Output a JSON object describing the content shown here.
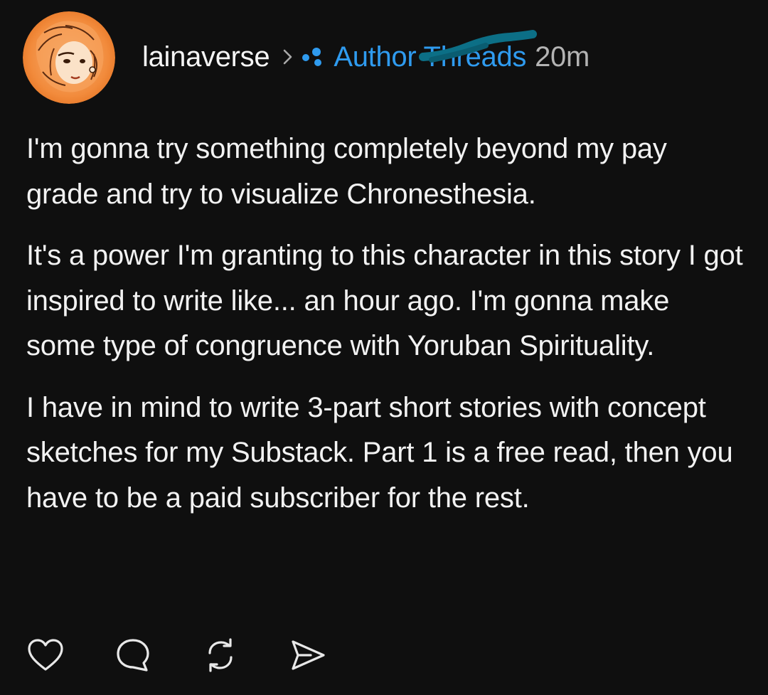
{
  "post": {
    "author": "lainaverse",
    "thread": "Author Threads",
    "timestamp": "20m",
    "paragraphs": [
      "I'm gonna try something completely beyond my pay grade and try to visualize Chronesthesia.",
      "It's a power I'm granting to this character in this story I got inspired to write like... an hour ago. I'm gonna make some type of congruence with Yoruban Spirituality.",
      "I have in mind to write 3-part short stories with concept sketches for my Substack. Part 1 is a free read, then you have to be a paid subscriber for the rest."
    ]
  },
  "icons": {
    "avatar": "avatar",
    "chevron": "chevron-right-icon",
    "thread": "thread-icon",
    "like": "heart-icon",
    "comment": "comment-icon",
    "restack": "restack-icon",
    "share": "send-icon"
  },
  "colors": {
    "background": "#0f0f0f",
    "text": "#f2f2f2",
    "link": "#2f9bef",
    "muted": "#b3b3b3"
  }
}
